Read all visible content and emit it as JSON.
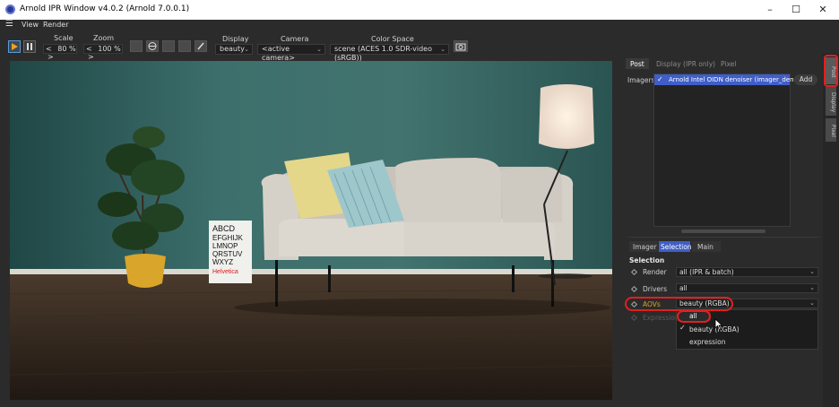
{
  "window": {
    "title": "Arnold IPR Window v4.0.2 (Arnold 7.0.0.1)"
  },
  "menu": {
    "view": "View",
    "render": "Render"
  },
  "toolbar": {
    "scale_label": "Scale",
    "scale_value": "80 %",
    "zoom_label": "Zoom",
    "zoom_value": "100 %",
    "display_label": "Display",
    "display_value": "beauty",
    "camera_label": "Camera",
    "camera_value": "<active camera>",
    "colorspace_label": "Color Space",
    "colorspace_value": "scene (ACES 1.0 SDR-video (sRGB))",
    "stepper_left": "<",
    "stepper_right": ">"
  },
  "viewport": {
    "poster_lines": [
      "ABCD",
      "EFGHIJK",
      "LMNOP",
      "QRSTUV",
      "WXYZ",
      "Helvetica"
    ]
  },
  "panel": {
    "top_tabs": [
      "Post",
      "Display (IPR only)",
      "Pixel"
    ],
    "imagers_label": "Imagers",
    "imager_item": "Arnold Intel OIDN denoiser (imager_denois",
    "add_button": "Add",
    "sub_tabs": [
      "Imager",
      "Selection",
      "Main"
    ],
    "section_title": "Selection",
    "rows": [
      {
        "label": "Render",
        "value": "all (IPR & batch)"
      },
      {
        "label": "Drivers",
        "value": "all"
      },
      {
        "label": "AOVs",
        "value": "beauty (RGBA)"
      },
      {
        "label": "Expression",
        "value": ""
      }
    ],
    "dropdown_options": [
      {
        "label": "all",
        "checked": false,
        "highlighted": true
      },
      {
        "label": "beauty (RGBA)",
        "checked": true,
        "highlighted": false
      },
      {
        "label": "expression",
        "checked": false,
        "highlighted": false
      }
    ]
  },
  "side_tabs": [
    "Post",
    "Display",
    "Pixel"
  ],
  "colors": {
    "accent": "#5a9ad8",
    "highlight_tab": "#3f5ec8",
    "annotation_red": "#e02020",
    "aovs_label": "#e0a020"
  }
}
